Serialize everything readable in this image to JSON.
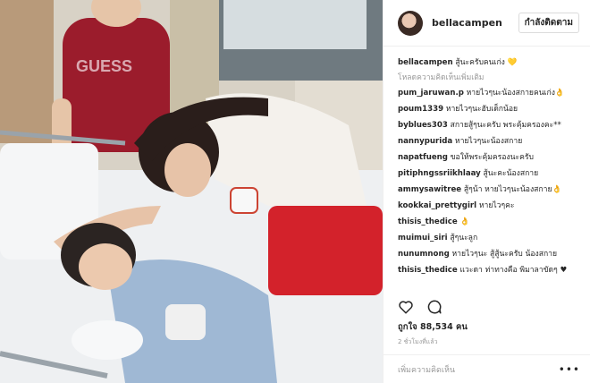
{
  "header": {
    "username": "bellacampen",
    "follow_label": "กำลังติดตาม"
  },
  "caption": {
    "user": "bellacampen",
    "text": "สู้นะครับคนเก่ง",
    "emoji": "💛"
  },
  "load_more": "โหลดความคิดเห็นเพิ่มเติม",
  "comments": [
    {
      "user": "pum_jaruwan.p",
      "text": "หายไวๆนะน้องสกายคนเก่ง👌"
    },
    {
      "user": "poum1339",
      "text": "หายไวๆนะฮับเด็กน้อย"
    },
    {
      "user": "byblues303",
      "text": "สกายสู้ๆนะครับ พระคุ้มครองคะ**"
    },
    {
      "user": "nannypurida",
      "text": "หายไวๆนะน้องสกาย"
    },
    {
      "user": "napatfueng",
      "text": "ขอให้พระคุ้มครองนะครับ"
    },
    {
      "user": "pitiphngssriikhlaay",
      "text": "สู้นะคะน้องสกาย"
    },
    {
      "user": "ammysawitree",
      "text": "สู้ๆน้า หายไวๆนะน้องสกาย👌"
    },
    {
      "user": "kookkai_prettygirl",
      "text": "หายไวๆคะ"
    },
    {
      "user": "thisis_thedice",
      "text": "👌"
    },
    {
      "user": "muimui_siri",
      "text": "สู้ๆนะลูก"
    },
    {
      "user": "nunumnong",
      "text": "หายไวๆนะ สู้สู้นะครับ น้องสกาย"
    },
    {
      "user": "thisis_thedice",
      "text": "แวะดา ท่าทางคือ พิมาลาขัดๆ ♥"
    }
  ],
  "actions": {
    "like_icon": "heart-icon",
    "comment_icon": "comment-icon"
  },
  "likes": "ถูกใจ 88,534 คน",
  "timestamp": "2 ชั่วโมงที่แล้ว",
  "add_comment_placeholder": "เพิ่มความคิดเห็น",
  "more_icon": "more-options-icon",
  "photo_shirt_text": "GUESS"
}
